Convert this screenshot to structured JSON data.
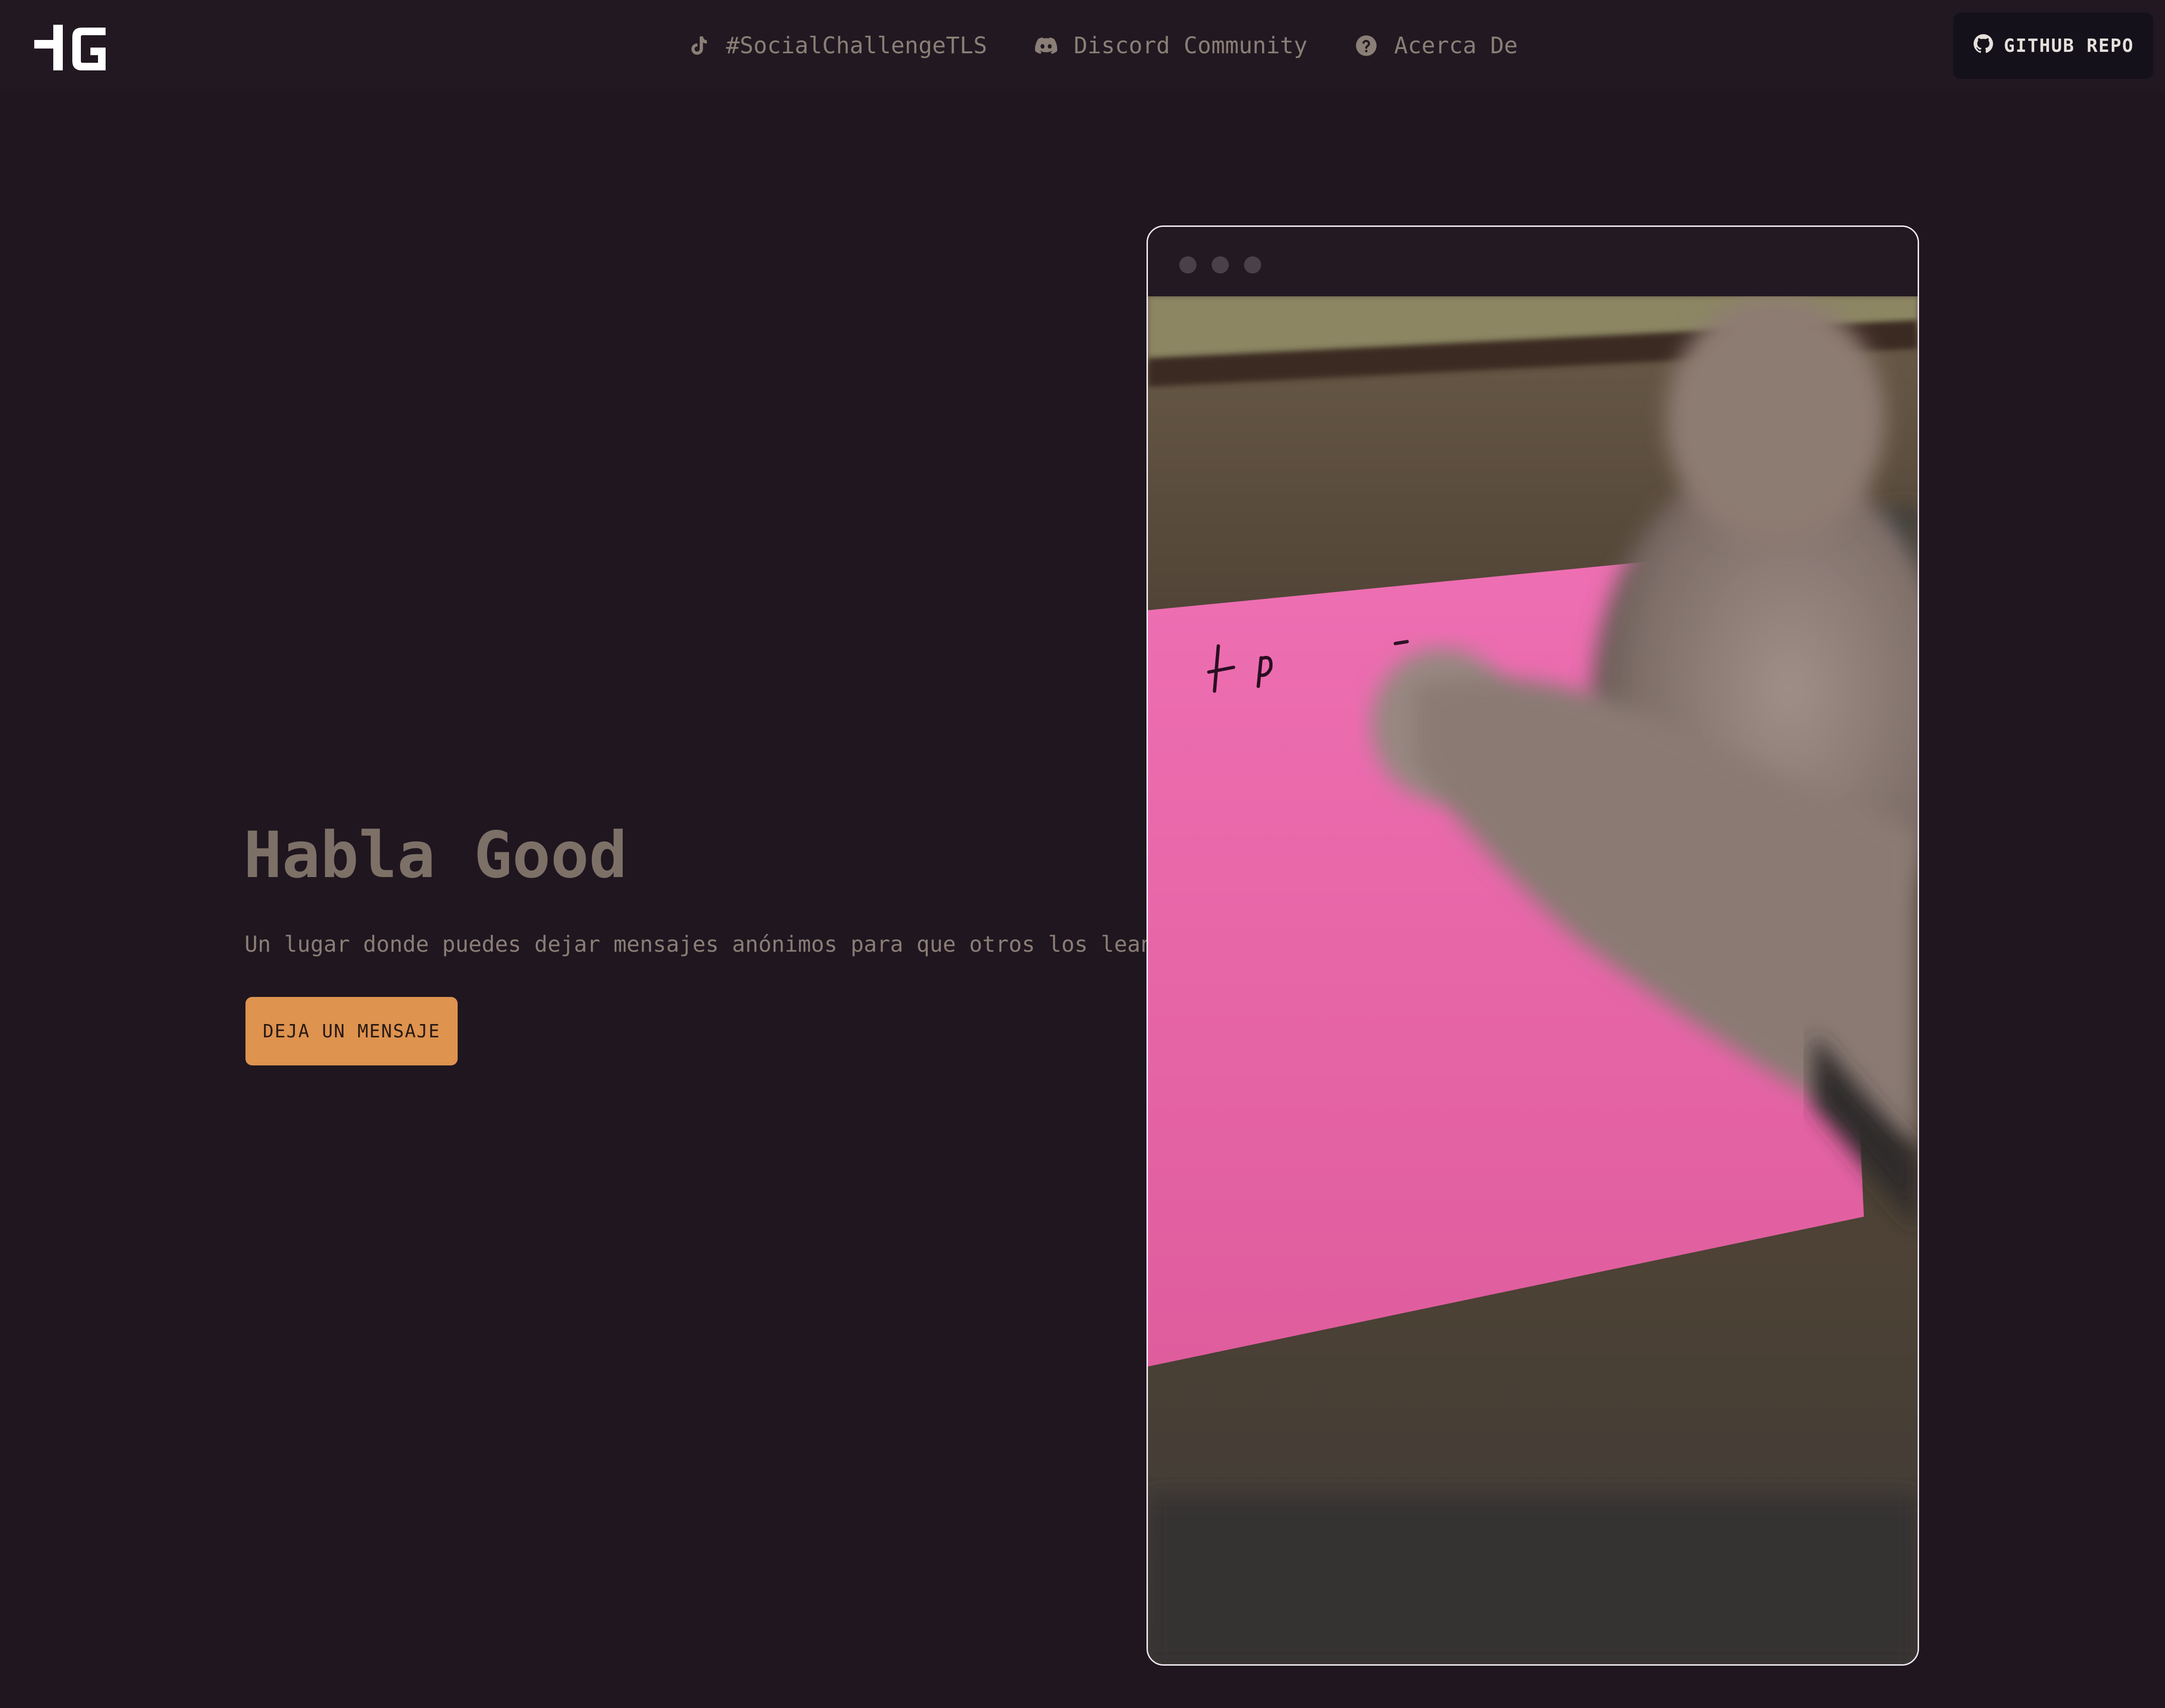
{
  "navbar": {
    "logo_text": "HG",
    "links": [
      {
        "label": "#SocialChallengeTLS",
        "icon": "tiktok-icon"
      },
      {
        "label": "Discord Community",
        "icon": "discord-icon"
      },
      {
        "label": "Acerca De",
        "icon": "question-circle-icon"
      }
    ],
    "github_button": {
      "label": "GITHUB REPO",
      "icon": "github-icon"
    }
  },
  "hero": {
    "title": "Habla Good",
    "subtitle": "Un lugar donde puedes dejar mensajes anónimos para que otros los lean.",
    "cta_label": "DEJA UN MENSAJE"
  },
  "mockup": {
    "window_dots": 3,
    "video_note_text": "+e"
  },
  "colors": {
    "background": "#1f161f",
    "navbar": "#211821",
    "accent": "#de934f",
    "github_button": "#15111a",
    "note_pink": "#e4619f"
  }
}
